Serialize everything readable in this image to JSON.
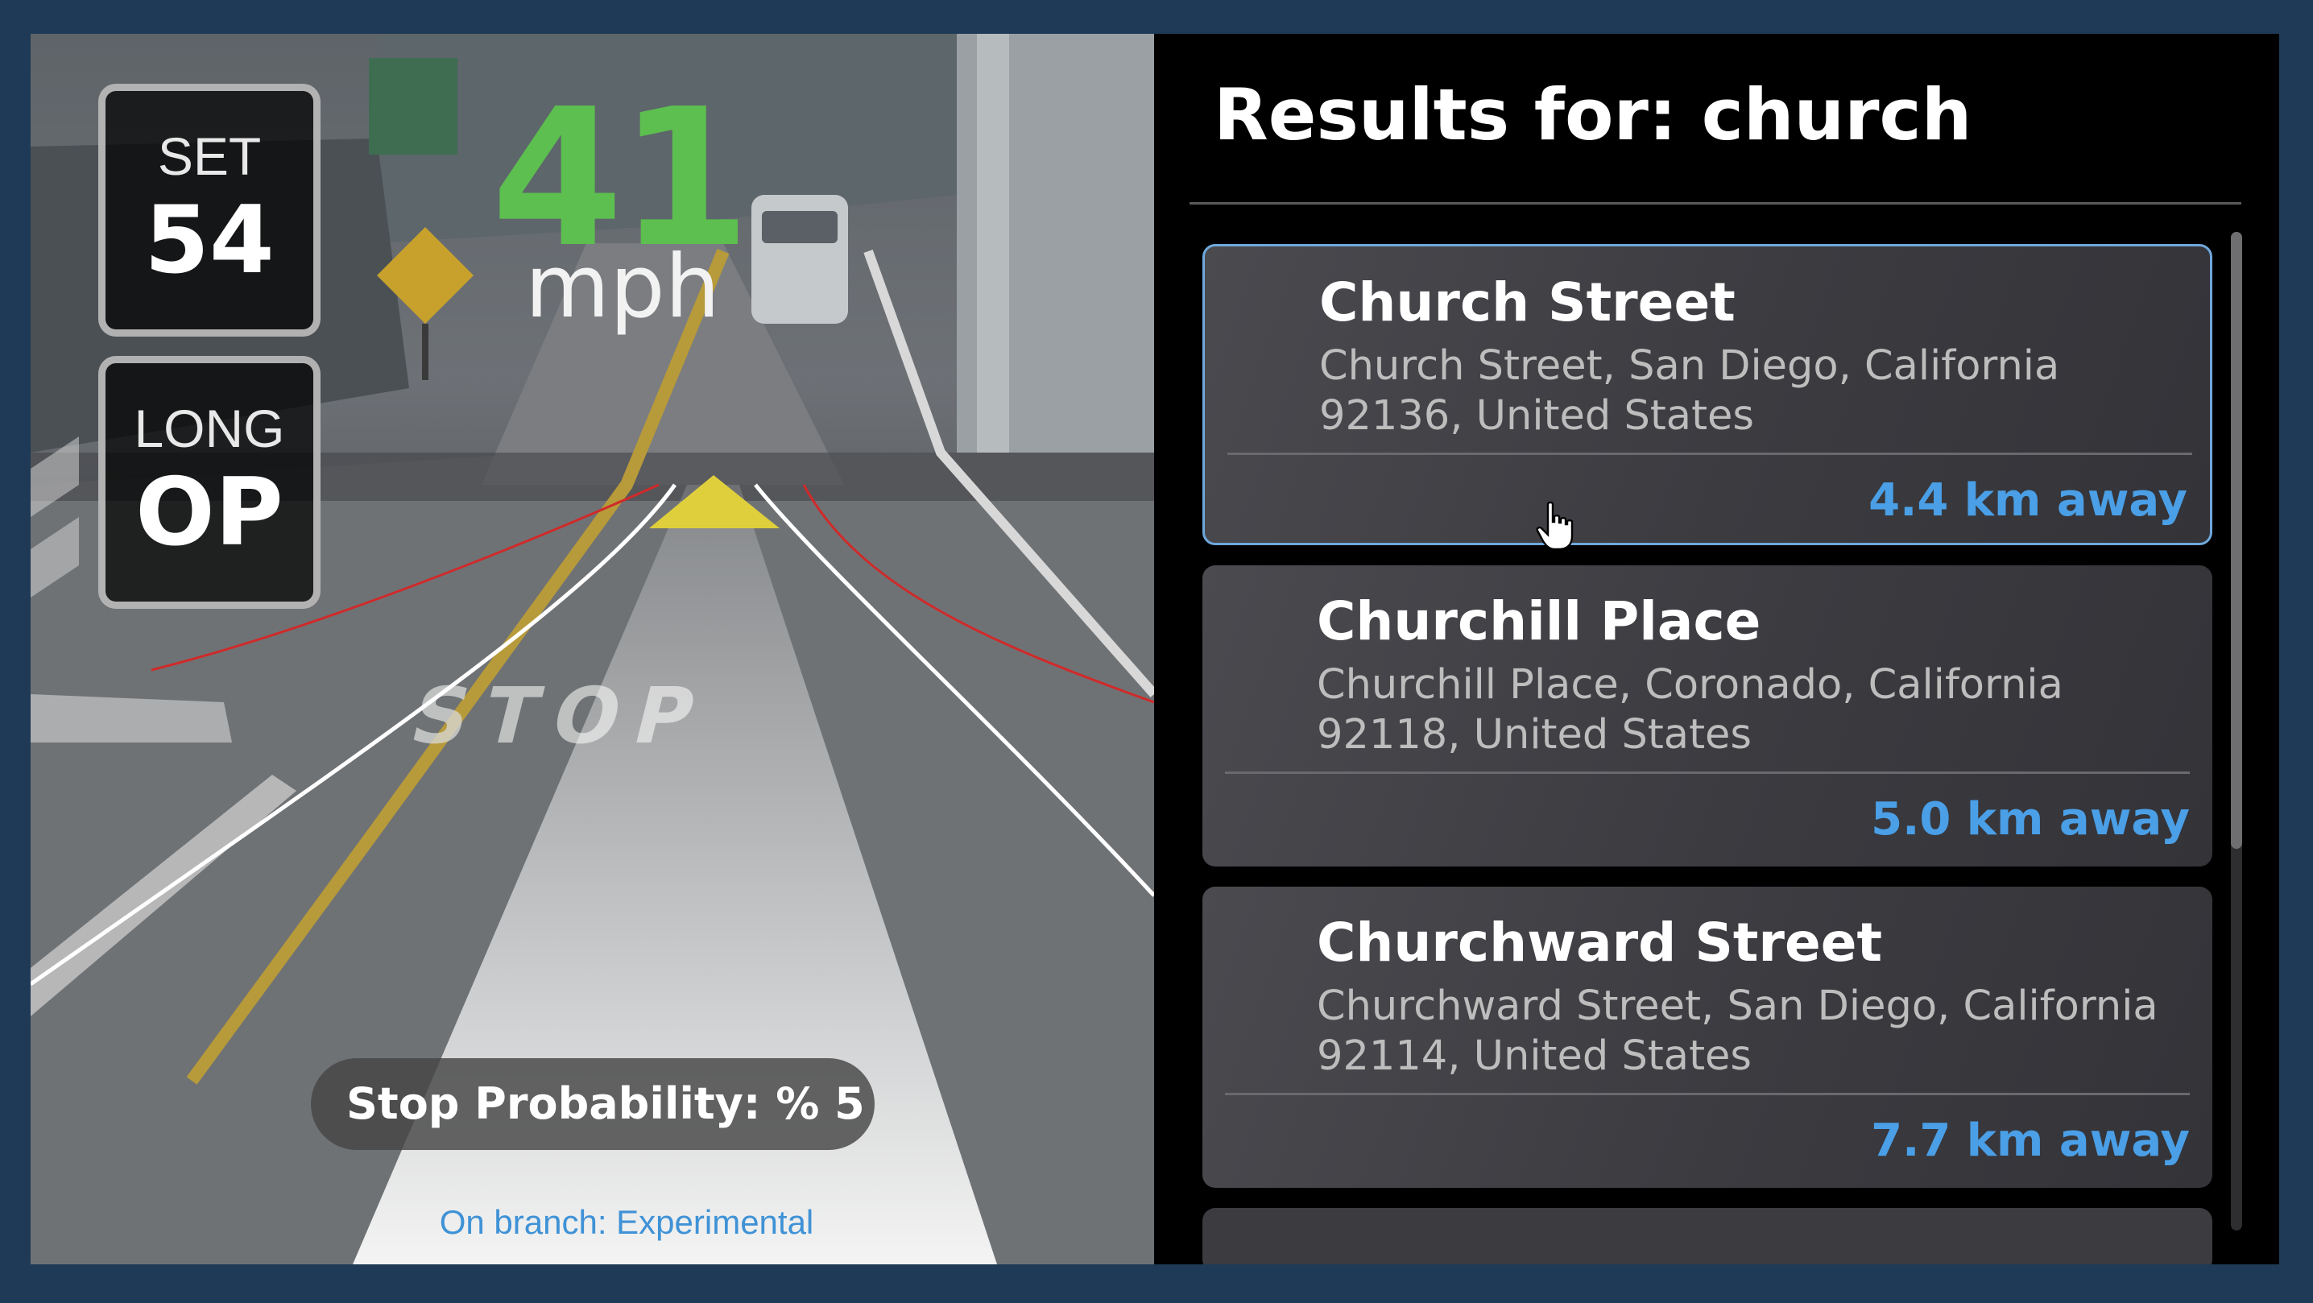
{
  "hud": {
    "set_label": "SET",
    "set_value": "54",
    "long_label": "LONG",
    "long_value": "OP",
    "speed": "41",
    "speed_unit": "mph",
    "stop_probability": "Stop Probability: % 5",
    "branch": "On branch: Experimental",
    "road_marking": "STOP"
  },
  "search": {
    "title": "Results for: church"
  },
  "results": [
    {
      "name": "Church Street",
      "address_line1": "Church Street, San Diego, California",
      "address_line2": "92136, United States",
      "distance": "4.4 km away",
      "selected": true
    },
    {
      "name": "Churchill Place",
      "address_line1": "Churchill Place, Coronado, California",
      "address_line2": "92118, United States",
      "distance": "5.0 km away",
      "selected": false
    },
    {
      "name": "Churchward Street",
      "address_line1": "Churchward Street, San Diego, California",
      "address_line2": "92114, United States",
      "distance": "7.7 km away",
      "selected": false
    }
  ],
  "colors": {
    "speed": "#5cbf4f",
    "distance": "#4a9fe6",
    "branch": "#3f92d6",
    "lead_marker": "#e0cf3c",
    "selection_border": "#6fa8dc"
  }
}
